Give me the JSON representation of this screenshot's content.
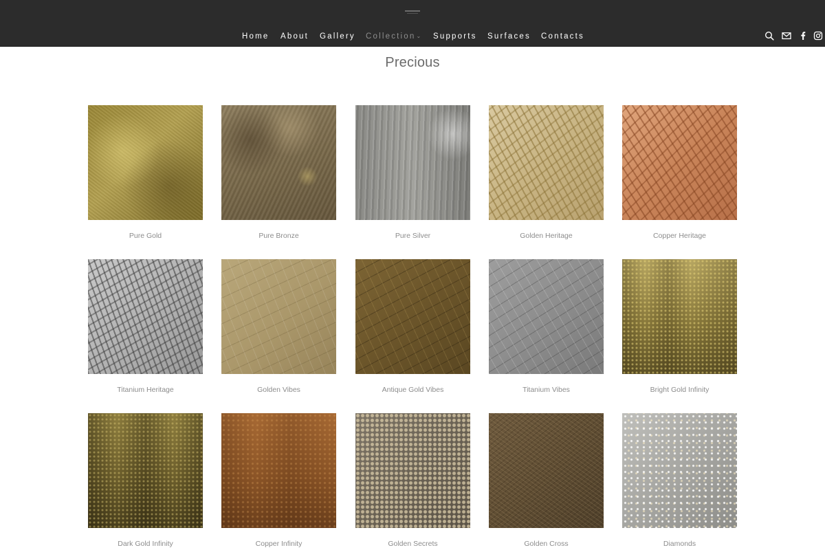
{
  "nav": {
    "items": [
      {
        "label": "Home"
      },
      {
        "label": "About"
      },
      {
        "label": "Gallery"
      },
      {
        "label": "Collection",
        "active": true
      },
      {
        "label": "Supports"
      },
      {
        "label": "Surfaces"
      },
      {
        "label": "Contacts"
      }
    ],
    "caret": "⌄"
  },
  "header_icons": [
    "search-icon",
    "mail-icon",
    "facebook-icon",
    "instagram-icon"
  ],
  "page": {
    "title": "Precious"
  },
  "swatches": [
    {
      "name": "Pure Gold"
    },
    {
      "name": "Pure Bronze"
    },
    {
      "name": "Pure Silver"
    },
    {
      "name": "Golden Heritage"
    },
    {
      "name": "Copper Heritage"
    },
    {
      "name": "Titanium Heritage"
    },
    {
      "name": "Golden Vibes"
    },
    {
      "name": "Antique Gold Vibes"
    },
    {
      "name": "Titanium Vibes"
    },
    {
      "name": "Bright Gold Infinity"
    },
    {
      "name": "Dark Gold Infinity"
    },
    {
      "name": "Copper Infinity"
    },
    {
      "name": "Golden Secrets"
    },
    {
      "name": "Golden Cross"
    },
    {
      "name": "Diamonds"
    }
  ],
  "colors": {
    "header_bg": "#2c2c2c",
    "nav_text": "#ffffff",
    "nav_active": "#8e8e8e",
    "title_text": "#6a6a6a",
    "caption_text": "#8c8c8c"
  }
}
